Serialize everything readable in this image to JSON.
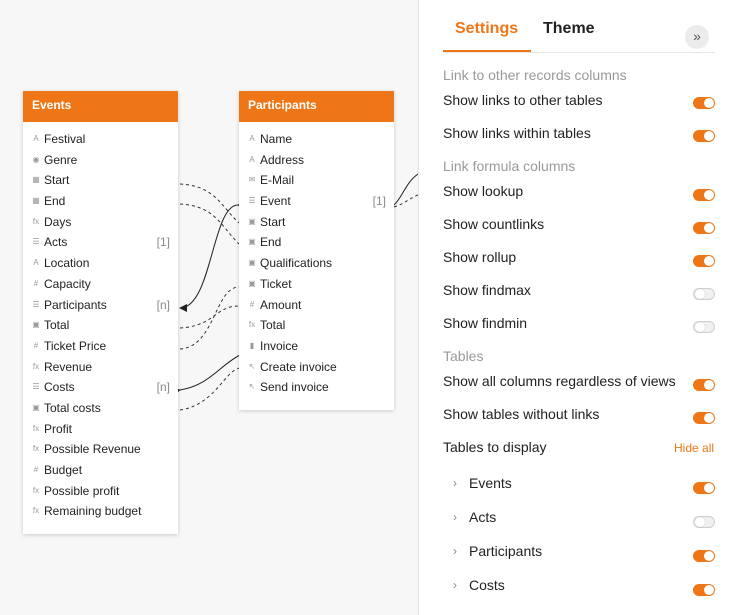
{
  "colors": {
    "accent": "#ef7616",
    "muted": "#9a9a9a",
    "text": "#222222"
  },
  "tables": [
    {
      "id": "events",
      "title": "Events",
      "fields": [
        {
          "icon": "text-icon",
          "glyph": "A",
          "label": "Festival",
          "badge": ""
        },
        {
          "icon": "single-select-icon",
          "glyph": "◉",
          "label": "Genre",
          "badge": ""
        },
        {
          "icon": "date-icon",
          "glyph": "▦",
          "label": "Start",
          "badge": ""
        },
        {
          "icon": "date-icon",
          "glyph": "▦",
          "label": "End",
          "badge": ""
        },
        {
          "icon": "formula-icon",
          "glyph": "fx",
          "label": "Days",
          "badge": ""
        },
        {
          "icon": "link-icon",
          "glyph": "☰",
          "label": "Acts",
          "badge": "[1]"
        },
        {
          "icon": "text-icon",
          "glyph": "A",
          "label": "Location",
          "badge": ""
        },
        {
          "icon": "number-icon",
          "glyph": "#",
          "label": "Capacity",
          "badge": ""
        },
        {
          "icon": "link-icon",
          "glyph": "☰",
          "label": "Participants",
          "badge": "[n]"
        },
        {
          "icon": "rollup-icon",
          "glyph": "▣",
          "label": "Total",
          "badge": ""
        },
        {
          "icon": "number-icon",
          "glyph": "#",
          "label": "Ticket Price",
          "badge": ""
        },
        {
          "icon": "formula-icon",
          "glyph": "fx",
          "label": "Revenue",
          "badge": ""
        },
        {
          "icon": "link-icon",
          "glyph": "☰",
          "label": "Costs",
          "badge": "[n]"
        },
        {
          "icon": "rollup-icon",
          "glyph": "▣",
          "label": "Total costs",
          "badge": ""
        },
        {
          "icon": "formula-icon",
          "glyph": "fx",
          "label": "Profit",
          "badge": ""
        },
        {
          "icon": "formula-icon",
          "glyph": "fx",
          "label": "Possible Revenue",
          "badge": ""
        },
        {
          "icon": "number-icon",
          "glyph": "#",
          "label": "Budget",
          "badge": ""
        },
        {
          "icon": "formula-icon",
          "glyph": "fx",
          "label": "Possible profit",
          "badge": ""
        },
        {
          "icon": "formula-icon",
          "glyph": "fx",
          "label": "Remaining budget",
          "badge": ""
        }
      ]
    },
    {
      "id": "participants",
      "title": "Participants",
      "fields": [
        {
          "icon": "text-icon",
          "glyph": "A",
          "label": "Name",
          "badge": ""
        },
        {
          "icon": "text-icon",
          "glyph": "A",
          "label": "Address",
          "badge": ""
        },
        {
          "icon": "email-icon",
          "glyph": "✉",
          "label": "E-Mail",
          "badge": ""
        },
        {
          "icon": "link-icon",
          "glyph": "☰",
          "label": "Event",
          "badge": "[1]"
        },
        {
          "icon": "lookup-icon",
          "glyph": "▣",
          "label": "Start",
          "badge": ""
        },
        {
          "icon": "lookup-icon",
          "glyph": "▣",
          "label": "End",
          "badge": ""
        },
        {
          "icon": "lookup-icon",
          "glyph": "▣",
          "label": "Qualifications",
          "badge": ""
        },
        {
          "icon": "lookup-icon",
          "glyph": "▣",
          "label": "Ticket",
          "badge": ""
        },
        {
          "icon": "number-icon",
          "glyph": "#",
          "label": "Amount",
          "badge": ""
        },
        {
          "icon": "formula-icon",
          "glyph": "fx",
          "label": "Total",
          "badge": ""
        },
        {
          "icon": "file-icon",
          "glyph": "▮",
          "label": "Invoice",
          "badge": ""
        },
        {
          "icon": "button-icon",
          "glyph": "↖",
          "label": "Create invoice",
          "badge": ""
        },
        {
          "icon": "button-icon",
          "glyph": "↖",
          "label": "Send invoice",
          "badge": ""
        }
      ]
    }
  ],
  "panel": {
    "tabs": [
      "Settings",
      "Theme"
    ],
    "active_tab": "Settings",
    "collapse_icon": "double-chevron-right-icon",
    "sections": [
      {
        "title": "Link to other records columns",
        "settings": [
          {
            "label": "Show links to other tables",
            "on": true
          },
          {
            "label": "Show links within tables",
            "on": true
          }
        ]
      },
      {
        "title": "Link formula columns",
        "settings": [
          {
            "label": "Show lookup",
            "on": true
          },
          {
            "label": "Show countlinks",
            "on": true
          },
          {
            "label": "Show rollup",
            "on": true
          },
          {
            "label": "Show findmax",
            "on": false
          },
          {
            "label": "Show findmin",
            "on": false
          }
        ]
      },
      {
        "title": "Tables",
        "settings": [
          {
            "label": "Show all columns regardless of views",
            "on": true
          },
          {
            "label": "Show tables without links",
            "on": true
          }
        ]
      }
    ],
    "tables_to_display": {
      "label": "Tables to display",
      "hide_all": "Hide all",
      "items": [
        {
          "label": "Events",
          "on": true
        },
        {
          "label": "Acts",
          "on": false
        },
        {
          "label": "Participants",
          "on": true
        },
        {
          "label": "Costs",
          "on": true
        }
      ]
    }
  }
}
